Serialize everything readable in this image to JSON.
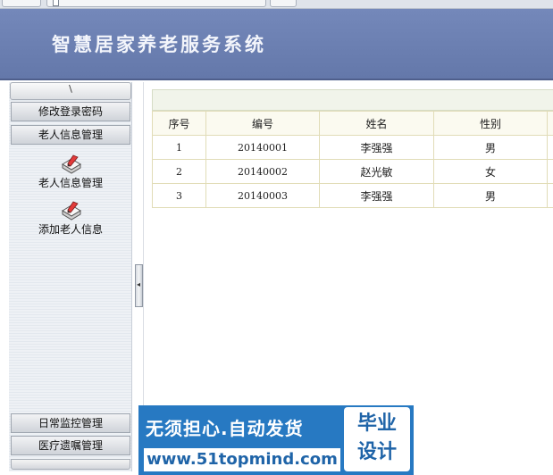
{
  "header": {
    "title": "智慧居家养老服务系统"
  },
  "sidebar": {
    "collapse_glyph": "\\",
    "menu": [
      {
        "label": "修改登录密码"
      },
      {
        "label": "老人信息管理"
      }
    ],
    "sub_items": [
      {
        "label": "老人信息管理",
        "icon": "pen-document-icon"
      },
      {
        "label": "添加老人信息",
        "icon": "pen-document-icon"
      }
    ],
    "bottom_menu": [
      {
        "label": "日常监控管理"
      },
      {
        "label": "医疗遗嘱管理"
      }
    ]
  },
  "splitter": {
    "glyph": "◂"
  },
  "table": {
    "columns": [
      "序号",
      "编号",
      "姓名",
      "性别"
    ],
    "rows": [
      [
        "1",
        "20140001",
        "李强强",
        "男"
      ],
      [
        "2",
        "20140002",
        "赵光敏",
        "女"
      ],
      [
        "3",
        "20140003",
        "李强强",
        "男"
      ]
    ]
  },
  "watermark": {
    "line1": "无须担心.自动发货",
    "line2": "www.51topmind.com",
    "badge_line1": "毕业",
    "badge_line2": "设计"
  },
  "colors": {
    "header": "#6b7fb0",
    "table_border": "#e1dcb7",
    "watermark": "#2779c2"
  }
}
